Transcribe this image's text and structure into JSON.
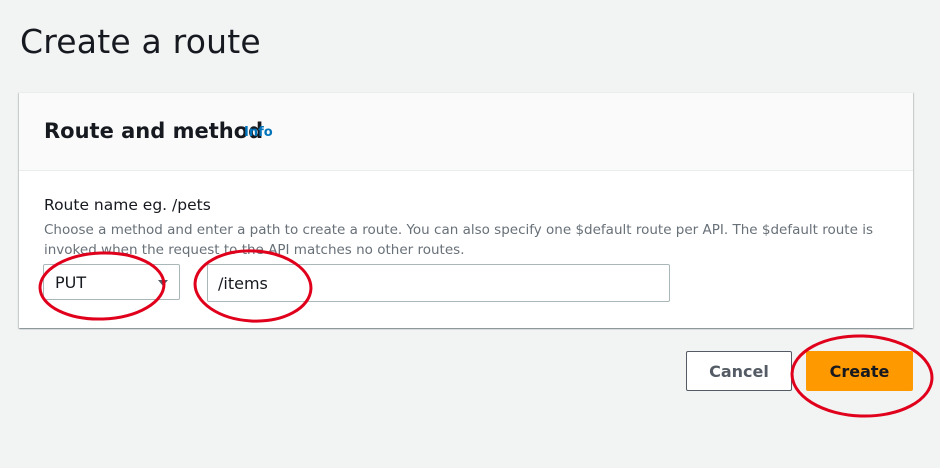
{
  "page": {
    "title": "Create a route"
  },
  "panel": {
    "title": "Route and method",
    "info_link": "Info",
    "field_label": "Route name eg. /pets",
    "field_description": "Choose a method and enter a path to create a route. You can also specify one $default route per API. The $default route is invoked when the request to the API matches no other routes.",
    "method_value": "PUT",
    "route_value": "/items"
  },
  "actions": {
    "cancel_label": "Cancel",
    "create_label": "Create"
  },
  "colors": {
    "primary_button": "#ff9900",
    "link": "#0073bb",
    "annotation": "#e0001b"
  },
  "icons": {
    "method_dropdown": "caret-down-icon"
  }
}
